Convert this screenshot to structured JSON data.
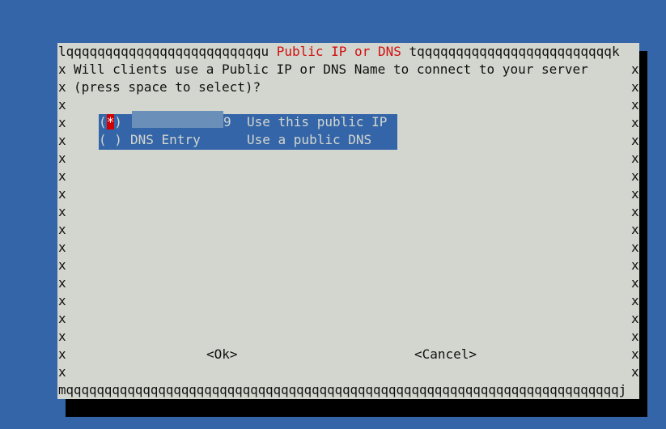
{
  "dialog": {
    "title": " Public IP or DNS ",
    "border_top_left": "lqqqqqqqqqqqqqqqqqqqqqqqqqu",
    "border_top_right": "tqqqqqqqqqqqqqqqqqqqqqqqqqk",
    "border_bottom": "mqqqqqqqqqqqqqqqqqqqqqqqqqqqqqqqqqqqqqqqqqqqqqqqqqqqqqqqqqqqqqqqqqqqqqqqqj",
    "border_side": "x",
    "prompt_line1": "Will clients use a Public IP or DNS Name to connect to your server",
    "prompt_line2": "(press space to select)?"
  },
  "options": [
    {
      "marker": "(",
      "mark": "*",
      "marker_end": ")",
      "value_suffix": "9",
      "description": "Use this public IP",
      "selected": true
    },
    {
      "marker": "(",
      "mark": " ",
      "marker_end": ")",
      "value": "DNS Entry",
      "description": "Use a public DNS",
      "selected": false
    }
  ],
  "buttons": {
    "ok": "<Ok>",
    "cancel": "<Cancel>"
  },
  "colors": {
    "background": "#3465a8",
    "dialog": "#d3d6ce",
    "title": "#d01010",
    "highlight": "#3465a8",
    "selected_mark": "#d00000"
  }
}
